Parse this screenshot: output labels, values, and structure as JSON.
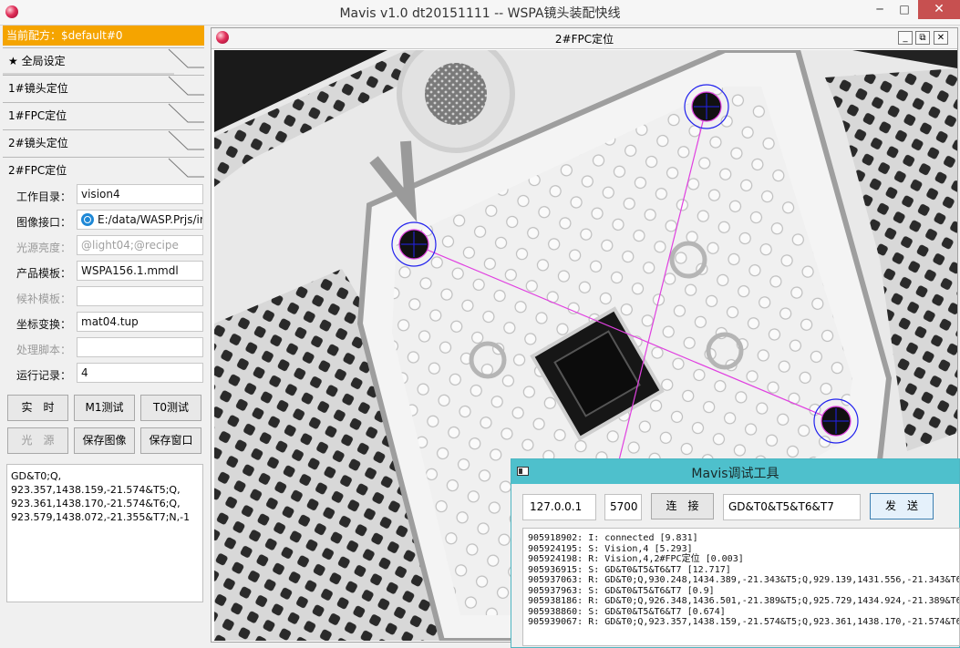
{
  "window": {
    "title": "Mavis v1.0 dt20151111 -- WSPA镜头装配快线",
    "min": "─",
    "max": "□",
    "close": "✕"
  },
  "sidebar": {
    "recipe": "当前配方：$default#0",
    "items": [
      {
        "label": "★ 全局设定"
      },
      {
        "label": "1#镜头定位"
      },
      {
        "label": "1#FPC定位"
      },
      {
        "label": "2#镜头定位"
      },
      {
        "label": "2#FPC定位"
      }
    ]
  },
  "form": [
    {
      "label": "工作目录：",
      "value": "vision4",
      "disabled": false
    },
    {
      "label": "图像接口：",
      "value": "E:/data/WASP.Prjs/im",
      "disabled": false
    },
    {
      "label": "光源亮度：",
      "value": "@light04;@recipe",
      "disabled": true
    },
    {
      "label": "产品模板：",
      "value": "WSPA156.1.mmdl",
      "disabled": false
    },
    {
      "label": "候补模板：",
      "value": "",
      "disabled": true
    },
    {
      "label": "坐标变换：",
      "value": "mat04.tup",
      "disabled": false
    },
    {
      "label": "处理脚本：",
      "value": "",
      "disabled": true
    },
    {
      "label": "运行记录：",
      "value": "4",
      "disabled": false
    }
  ],
  "buttons": {
    "realtime": "实　时",
    "m1test": "M1测试",
    "t0test": "T0测试",
    "light": "光　源",
    "save_image": "保存图像",
    "save_window": "保存窗口"
  },
  "result_text": "GD&T0;Q,\n923.357,1438.159,-21.574&T5;Q,\n923.361,1438.170,-21.574&T6;Q,\n923.579,1438.072,-21.355&T7;N,-1",
  "image_window": {
    "title": "2#FPC定位",
    "min": "_",
    "restore": "⧉",
    "close": "✕"
  },
  "colors": {
    "recipe_bar": "#f5a400",
    "debug_titlebar": "#4ec0cc",
    "close_button": "#c75050",
    "overlay_line": "#e040e0",
    "overlay_circle": "#2222ee"
  },
  "debug_tool": {
    "title": "Mavis调试工具",
    "ip": "127.0.0.1",
    "port": "5700",
    "connect": "连　接",
    "command": "GD&T0&T5&T6&T7",
    "send": "发　送",
    "log": [
      "905918902: I: connected [9.831]",
      "905924195: S: Vision,4 [5.293]",
      "905924198: R: Vision,4,2#FPC定位 [0.003]",
      "905936915: S: GD&T0&T5&T6&T7 [12.717]",
      "905937063: R: GD&T0;Q,930.248,1434.389,-21.343&T5;Q,929.139,1431.556,-21.343&T6",
      "905937963: S: GD&T0&T5&T6&T7 [0.9]",
      "905938186: R: GD&T0;Q,926.348,1436.501,-21.389&T5;Q,925.729,1434.924,-21.389&T6",
      "905938860: S: GD&T0&T5&T6&T7 [0.674]",
      "905939067: R: GD&T0;Q,923.357,1438.159,-21.574&T5;Q,923.361,1438.170,-21.574&T6"
    ]
  }
}
